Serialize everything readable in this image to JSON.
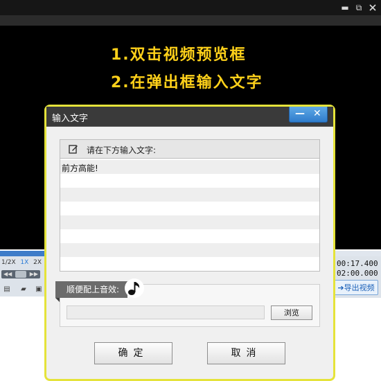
{
  "window": {
    "minimize": "▬",
    "restore": "⧉"
  },
  "video": {
    "hint_line1": "1.双击视频预览框",
    "hint_line2": "2.在弹出框输入文字",
    "hint_color": "#ffd11a",
    "progress_fraction": 0.12
  },
  "playback": {
    "speeds": [
      "1/2X",
      "1X",
      "2X"
    ],
    "active_speed": "1X",
    "current_time": "00:17.400",
    "total_time": "02:00.000",
    "export_label": "导出视频"
  },
  "dialog": {
    "title": "输入文字",
    "minimize_label": "—",
    "close_label": "✕",
    "text_section_label": "请在下方输入文字:",
    "text_value": "前方高能!",
    "music_section_label": "顺便配上音效:",
    "music_path": "",
    "browse_label": "浏览",
    "ok_label": "确定",
    "cancel_label": "取消",
    "highlight_color": "#e5e33a"
  }
}
